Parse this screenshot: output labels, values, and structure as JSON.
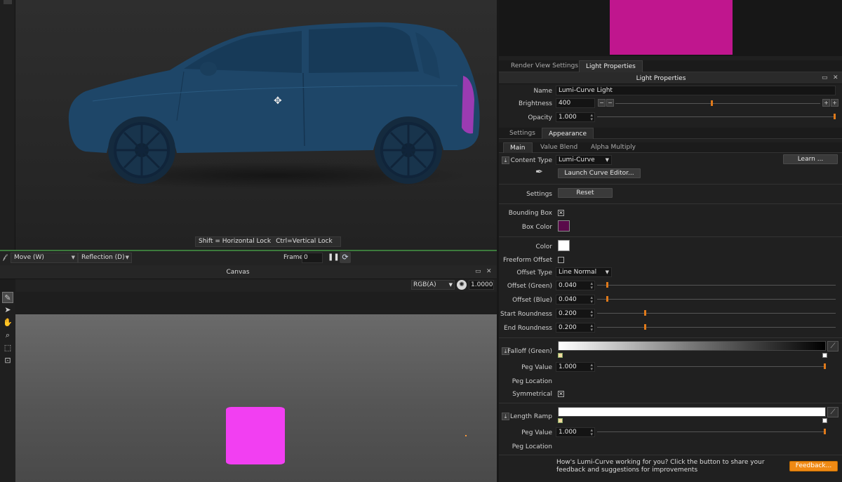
{
  "render_view": {
    "lock_hint_horizontal": "Shift = Horizontal Lock",
    "lock_hint_vertical": "Ctrl=Vertical Lock"
  },
  "render_toolbar": {
    "tool_select": "Move (W)",
    "reflection_select": "Reflection (D)",
    "frame_label": "Frame",
    "frame_value": "0"
  },
  "canvas": {
    "title": "Canvas",
    "channel_select": "RGB(A)",
    "exposure_value": "1.0000"
  },
  "right_panel": {
    "tabs": [
      {
        "label": "Render View Settings"
      },
      {
        "label": "Light Properties"
      }
    ],
    "header_title": "Light Properties",
    "name_label": "Name",
    "name_value": "Lumi-Curve Light",
    "brightness_label": "Brightness",
    "brightness_value": "400",
    "brightness_slider_level": 0.47,
    "opacity_label": "Opacity",
    "opacity_value": "1.000",
    "opacity_slider_level": 1.0,
    "sub_tabs": [
      {
        "label": "Settings"
      },
      {
        "label": "Appearance"
      }
    ],
    "appearance_tabs": [
      {
        "label": "Main"
      },
      {
        "label": "Value Blend"
      },
      {
        "label": "Alpha Multiply"
      }
    ],
    "content_type_label": "Content Type",
    "content_type_value": "Lumi-Curve",
    "learn_button": "Learn ...",
    "launch_curve_editor_button": "Launch Curve Editor...",
    "settings_label": "Settings",
    "reset_button": "Reset",
    "bounding_box_label": "Bounding Box",
    "bounding_box_checked": true,
    "box_color_label": "Box Color",
    "box_color_hex": "#5a0b4a",
    "color_label": "Color",
    "color_hex": "#ffffff",
    "freeform_offset_label": "Freeform Offset",
    "freeform_offset_checked": false,
    "offset_type_label": "Offset Type",
    "offset_type_value": "Line Normal",
    "offset_green_label": "Offset (Green)",
    "offset_green_value": "0.040",
    "offset_green_level": 0.04,
    "offset_blue_label": "Offset (Blue)",
    "offset_blue_value": "0.040",
    "offset_blue_level": 0.04,
    "start_roundness_label": "Start Roundness",
    "start_roundness_value": "0.200",
    "start_roundness_level": 0.2,
    "end_roundness_label": "End Roundness",
    "end_roundness_value": "0.200",
    "end_roundness_level": 0.2,
    "falloff_label": "Falloff (Green)",
    "falloff_peg_value_label": "Peg Value",
    "falloff_peg_value": "1.000",
    "falloff_peg_level": 1.0,
    "falloff_peg_location_label": "Peg Location",
    "symmetrical_label": "Symmetrical",
    "symmetrical_checked": true,
    "length_ramp_label": "Length Ramp",
    "length_peg_value_label": "Peg Value",
    "length_peg_value": "1.000",
    "length_peg_level": 1.0,
    "length_peg_location_label": "Peg Location",
    "feedback_text": "How's Lumi-Curve working for you? Click the button to share your feedback and suggestions for improvements",
    "feedback_button": "Feedback..."
  },
  "colors": {
    "accent_orange": "#f08a14",
    "preview_magenta": "#c0168e",
    "canvas_magenta": "#f23ff2",
    "car_blue": "#1f4a6e"
  },
  "icons": {
    "move_cursor": "move-cursor-icon",
    "pause": "pause-icon",
    "loop": "loop-icon",
    "brush": "brush-icon",
    "pen": "pen-icon"
  }
}
